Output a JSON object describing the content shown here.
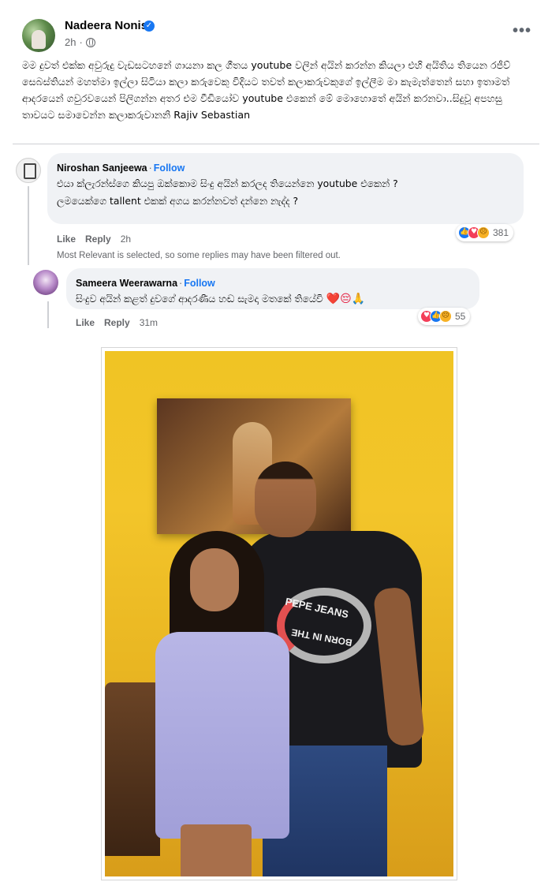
{
  "post": {
    "author": "Nadeera Nonis",
    "time": "2h",
    "text": "මම දුවත් එක්ක අවුරුදු වැඩසටහනේ ගායනා කල ගීතය youtube වලින් අයින් කරන්න කියලා එහි අයිතිය තියෙන රජීව් සෙබස්තියන් මහත්මා ඉල්ලා සිටියා කලා කරුවෙකු විදියට තවත් කලාකරුවකුගේ ඉල්ලීම මා කැමැත්තෙන් සහා ඉතාමත් ආදරයෙන් ගවුරවයෙන් පිලිගන්න අතර එම වීඩියෝව youtube එකෙන් මේ මොහොතේ අයින් කරනවා..සිදුවූ අපහසු තාවයට සමාවෙන්න කලාකරුවානනි Rajiv Sebastian"
  },
  "comments": [
    {
      "name": "Niroshan Sanjeewa",
      "follow": "Follow",
      "text_line1": "එයා ක්ලැරන්ස්ගෙ කියපු ඔක්කොම සිංදු අයින් කරලද තියෙන්නෙ youtube එකෙන් ?",
      "text_line2": "ලමයෙක්ගෙ tallent එකක් අගය කරන්නවත් දන්නෙ නැද්ද ?",
      "like": "Like",
      "reply": "Reply",
      "time": "2h",
      "reaction_count": "381"
    },
    {
      "name": "Sameera Weerawarna",
      "follow": "Follow",
      "text": "සිංදුව අයින් කළත් දුවගේ ආදරණීය හඬ සැමදා මතකේ තියේවි",
      "emojis": "❤️😔🙏",
      "like": "Like",
      "reply": "Reply",
      "time": "31m",
      "reaction_count": "55"
    }
  ],
  "filter_note": "Most Relevant is selected, so some replies may have been filtered out.",
  "photo": {
    "shirt_text_1": "PEPE JEANS",
    "shirt_text_2": "BORN IN THE"
  },
  "colors": {
    "link": "#1877f2",
    "muted": "#65676b",
    "bubble": "#f0f2f5"
  },
  "icons": [
    "verified-badge-icon",
    "globe-icon",
    "more-options-icon",
    "like-reaction-icon",
    "love-reaction-icon",
    "care-reaction-icon"
  ]
}
